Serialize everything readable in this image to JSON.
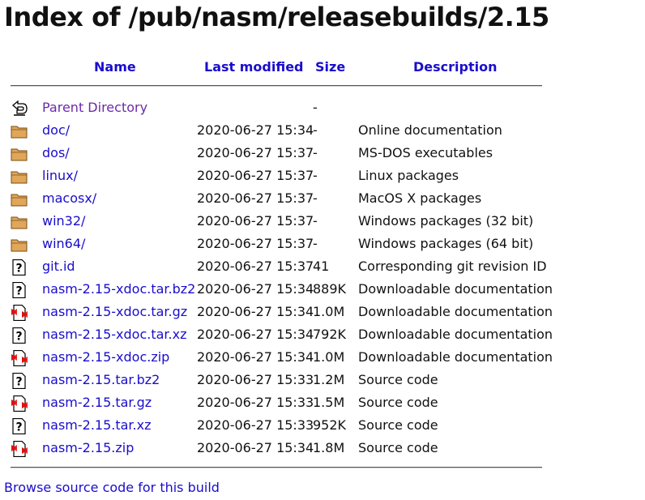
{
  "page": {
    "title": "Index of /pub/nasm/releasebuilds/2.15"
  },
  "table": {
    "headers": {
      "name": "Name",
      "last_modified": "Last modified",
      "size": "Size",
      "description": "Description"
    },
    "rows": [
      {
        "icon": "back-arrow-icon",
        "name": "Parent Directory",
        "date": "",
        "size": "-",
        "description": ""
      },
      {
        "icon": "folder-icon",
        "name": "doc/",
        "date": "2020-06-27 15:34",
        "size": "-",
        "description": "Online documentation"
      },
      {
        "icon": "folder-icon",
        "name": "dos/",
        "date": "2020-06-27 15:37",
        "size": "-",
        "description": "MS-DOS executables"
      },
      {
        "icon": "folder-icon",
        "name": "linux/",
        "date": "2020-06-27 15:37",
        "size": "-",
        "description": "Linux packages"
      },
      {
        "icon": "folder-icon",
        "name": "macosx/",
        "date": "2020-06-27 15:37",
        "size": "-",
        "description": "MacOS X packages"
      },
      {
        "icon": "folder-icon",
        "name": "win32/",
        "date": "2020-06-27 15:37",
        "size": "-",
        "description": "Windows packages (32 bit)"
      },
      {
        "icon": "folder-icon",
        "name": "win64/",
        "date": "2020-06-27 15:37",
        "size": "-",
        "description": "Windows packages (64 bit)"
      },
      {
        "icon": "unknown-file-icon",
        "name": "git.id",
        "date": "2020-06-27 15:37",
        "size": "41",
        "description": "Corresponding git revision ID"
      },
      {
        "icon": "unknown-file-icon",
        "name": "nasm-2.15-xdoc.tar.bz2",
        "date": "2020-06-27 15:34",
        "size": "889K",
        "description": "Downloadable documentation"
      },
      {
        "icon": "compressed-file-icon",
        "name": "nasm-2.15-xdoc.tar.gz",
        "date": "2020-06-27 15:34",
        "size": "1.0M",
        "description": "Downloadable documentation"
      },
      {
        "icon": "unknown-file-icon",
        "name": "nasm-2.15-xdoc.tar.xz",
        "date": "2020-06-27 15:34",
        "size": "792K",
        "description": "Downloadable documentation"
      },
      {
        "icon": "compressed-file-icon",
        "name": "nasm-2.15-xdoc.zip",
        "date": "2020-06-27 15:34",
        "size": "1.0M",
        "description": "Downloadable documentation"
      },
      {
        "icon": "unknown-file-icon",
        "name": "nasm-2.15.tar.bz2",
        "date": "2020-06-27 15:33",
        "size": "1.2M",
        "description": "Source code"
      },
      {
        "icon": "compressed-file-icon",
        "name": "nasm-2.15.tar.gz",
        "date": "2020-06-27 15:33",
        "size": "1.5M",
        "description": "Source code"
      },
      {
        "icon": "unknown-file-icon",
        "name": "nasm-2.15.tar.xz",
        "date": "2020-06-27 15:33",
        "size": "952K",
        "description": "Source code"
      },
      {
        "icon": "compressed-file-icon",
        "name": "nasm-2.15.zip",
        "date": "2020-06-27 15:34",
        "size": "1.8M",
        "description": "Source code"
      }
    ]
  },
  "footer": {
    "browse_link": "Browse source code for this build"
  },
  "colors": {
    "link": "#1a0dcc",
    "visited_link": "#6b2aa8",
    "text": "#111111",
    "rule": "#555555"
  }
}
